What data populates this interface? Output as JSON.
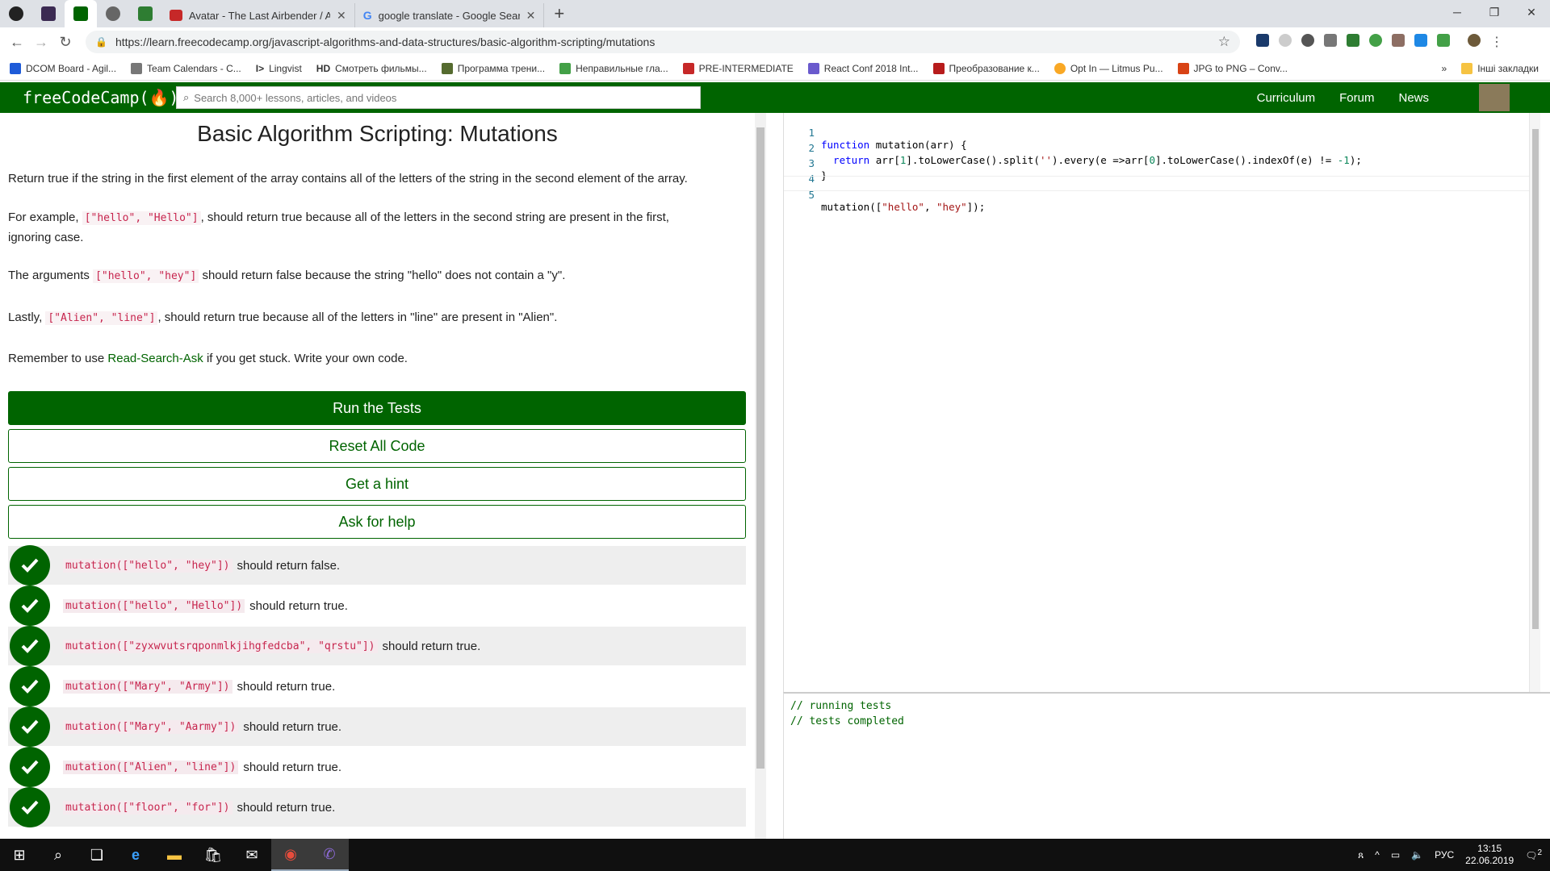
{
  "browser": {
    "tabs": [
      {
        "title": "Avatar - The Last Airbender / Aa"
      },
      {
        "title": "google translate - Google Search"
      }
    ],
    "new_tab": "+",
    "url": "https://learn.freecodecamp.org/javascript-algorithms-and-data-structures/basic-algorithm-scripting/mutations",
    "bookmarks": [
      "DCOM Board - Agil...",
      "Team Calendars - C...",
      "Lingvist",
      "Смотреть фильмы...",
      "Программа трени...",
      "Неправильные гла...",
      "PRE-INTERMEDIATE",
      "React Conf 2018 Int...",
      "Преобразование к...",
      "Opt In — Litmus Pu...",
      "JPG to PNG – Conv..."
    ],
    "other_bookmarks": "Інші закладки"
  },
  "fcc": {
    "logo": "freeCodeCamp(🔥)",
    "search_placeholder": "Search 8,000+ lessons, articles, and videos",
    "nav": [
      "Curriculum",
      "Forum",
      "News"
    ]
  },
  "challenge": {
    "title": "Basic Algorithm Scripting: Mutations",
    "p1": "Return true if the string in the first element of the array contains all of the letters of the string in the second element of the array.",
    "p2_pre": "For example, ",
    "p2_code": "[\"hello\", \"Hello\"]",
    "p2_post": ", should return true because all of the letters in the second string are present in the first,",
    "p2_line2": "ignoring case.",
    "p3_pre": "The arguments ",
    "p3_code": "[\"hello\", \"hey\"]",
    "p3_post": " should return false because the string \"hello\" does not contain a \"y\".",
    "p4_pre": "Lastly, ",
    "p4_code": "[\"Alien\", \"line\"]",
    "p4_post": ", should return true because all of the letters in \"line\" are present in \"Alien\".",
    "p5_pre": "Remember to use ",
    "p5_link": "Read-Search-Ask",
    "p5_post": " if you get stuck. Write your own code."
  },
  "buttons": {
    "run": "Run the Tests",
    "reset": "Reset All Code",
    "hint": "Get a hint",
    "help": "Ask for help"
  },
  "tests": [
    {
      "code": "mutation([\"hello\", \"hey\"])",
      "text": "should return false."
    },
    {
      "code": "mutation([\"hello\", \"Hello\"])",
      "text": "should return true."
    },
    {
      "code": "mutation([\"zyxwvutsrqponmlkjihgfedcba\", \"qrstu\"])",
      "text": "should return true."
    },
    {
      "code": "mutation([\"Mary\", \"Army\"])",
      "text": "should return true."
    },
    {
      "code": "mutation([\"Mary\", \"Aarmy\"])",
      "text": "should return true."
    },
    {
      "code": "mutation([\"Alien\", \"line\"])",
      "text": "should return true."
    },
    {
      "code": "mutation([\"floor\", \"for\"])",
      "text": "should return true."
    }
  ],
  "editor": {
    "lines": [
      "1",
      "2",
      "3",
      "4",
      "5"
    ],
    "l1_kw": "function",
    "l1_rest": " mutation(arr) {",
    "l2_kw": "  return",
    "l2_a": " arr[",
    "l2_n1": "1",
    "l2_b": "].toLowerCase().split(",
    "l2_s": "''",
    "l2_c": ").every(e =>arr[",
    "l2_n2": "0",
    "l2_d": "].toLowerCase().indexOf(e) != ",
    "l2_n3": "-1",
    "l2_e": ");",
    "l3": "}",
    "l5_a": "mutation([",
    "l5_s1": "\"hello\"",
    "l5_b": ", ",
    "l5_s2": "\"hey\"",
    "l5_c": "]);"
  },
  "output": [
    "// running tests",
    "// tests completed"
  ],
  "taskbar": {
    "lang": "РУС",
    "time": "13:15",
    "date": "22.06.2019",
    "notif": "2"
  },
  "colors": {
    "fcc_green": "#006400",
    "code_red": "#c7254e"
  }
}
